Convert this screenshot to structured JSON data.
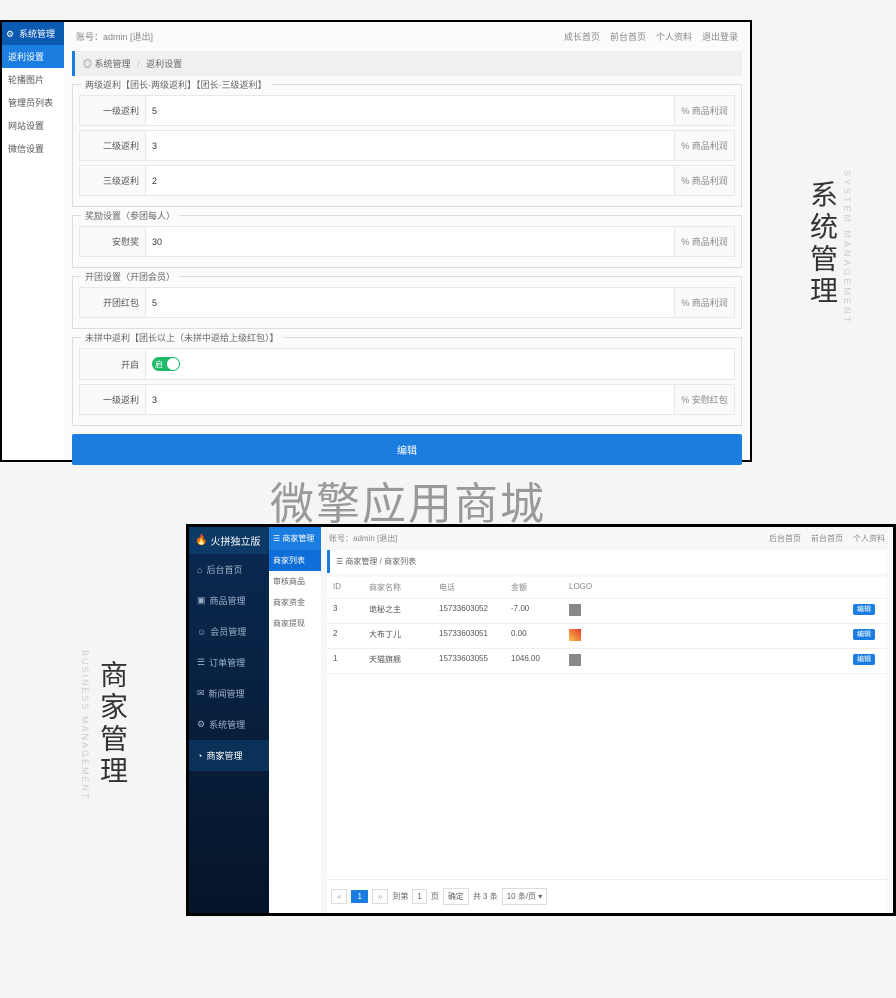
{
  "panel1": {
    "sidebar": {
      "header": "系统管理",
      "active": "返利设置",
      "items": [
        "轮播图片",
        "管理员列表",
        "网站设置",
        "微信设置"
      ]
    },
    "header": {
      "account_label": "账号：admin",
      "logout": "[退出]",
      "links": [
        "成长首页",
        "前台首页",
        "个人资料",
        "退出登录"
      ]
    },
    "crumb": {
      "root": "系统管理",
      "current": "返利设置"
    },
    "sections": [
      {
        "legend": "两级返利【团长·两级返利】【团长·三级返利】",
        "rows": [
          {
            "label": "一级返利",
            "value": "5",
            "suffix": "% 商品利润"
          },
          {
            "label": "二级返利",
            "value": "3",
            "suffix": "% 商品利润"
          },
          {
            "label": "三级返利",
            "value": "2",
            "suffix": "% 商品利润"
          }
        ]
      },
      {
        "legend": "奖励设置（参团每人）",
        "rows": [
          {
            "label": "安慰奖",
            "value": "30",
            "suffix": "% 商品利润"
          }
        ]
      },
      {
        "legend": "开团设置（开团会员）",
        "rows": [
          {
            "label": "开团红包",
            "value": "5",
            "suffix": "% 商品利润"
          }
        ]
      },
      {
        "legend": "未拼中返利【团长以上（未拼中返给上级红包）】",
        "toggle_row": {
          "label": "开启",
          "state": "启"
        },
        "rows": [
          {
            "label": "一级返利",
            "value": "3",
            "suffix": "% 安慰红包"
          }
        ]
      }
    ],
    "save": "编辑"
  },
  "watermark": "微擎应用商城",
  "label1": {
    "cn": "系统管理",
    "en": "SYSTEM MANAGEMENT"
  },
  "label2": {
    "cn": "商家管理",
    "en": "BUSINESS MANAGEMENT"
  },
  "panel2": {
    "brand": "火拼独立版",
    "sidebar": [
      {
        "icon": "home",
        "label": "后台首页"
      },
      {
        "icon": "goods",
        "label": "商品管理"
      },
      {
        "icon": "member",
        "label": "会员管理"
      },
      {
        "icon": "order",
        "label": "订单管理"
      },
      {
        "icon": "news",
        "label": "新闻管理"
      },
      {
        "icon": "system",
        "label": "系统管理"
      },
      {
        "icon": "shop",
        "label": "商家管理",
        "active": true
      }
    ],
    "submenu": {
      "header": "商家管理",
      "active": "商家列表",
      "items": [
        "审核商品",
        "商家资金",
        "商家提现"
      ]
    },
    "header": {
      "account_label": "账号：admin",
      "logout": "[退出]",
      "links": [
        "后台首页",
        "前台首页",
        "个人资料"
      ]
    },
    "crumb": {
      "root": "商家管理",
      "current": "商家列表"
    },
    "table": {
      "headers": {
        "id": "ID",
        "name": "商家名称",
        "tel": "电话",
        "amt": "金额",
        "logo": "LOGO",
        "act": ""
      },
      "rows": [
        {
          "id": "3",
          "name": "诡秘之主",
          "tel": "15733603052",
          "amt": "-7.00",
          "logo": "g"
        },
        {
          "id": "2",
          "name": "大布丁儿",
          "tel": "15733603051",
          "amt": "0.00",
          "logo": "y"
        },
        {
          "id": "1",
          "name": "天猫旗舰",
          "tel": "15733603055",
          "amt": "1046.00",
          "logo": "g"
        }
      ],
      "edit": "编辑"
    },
    "pager": {
      "prev": "«",
      "current": "1",
      "next": "»",
      "to_label": "到第",
      "page_unit": "页",
      "go": "确定",
      "total": "共 3 条",
      "size": "10 条/页"
    }
  }
}
